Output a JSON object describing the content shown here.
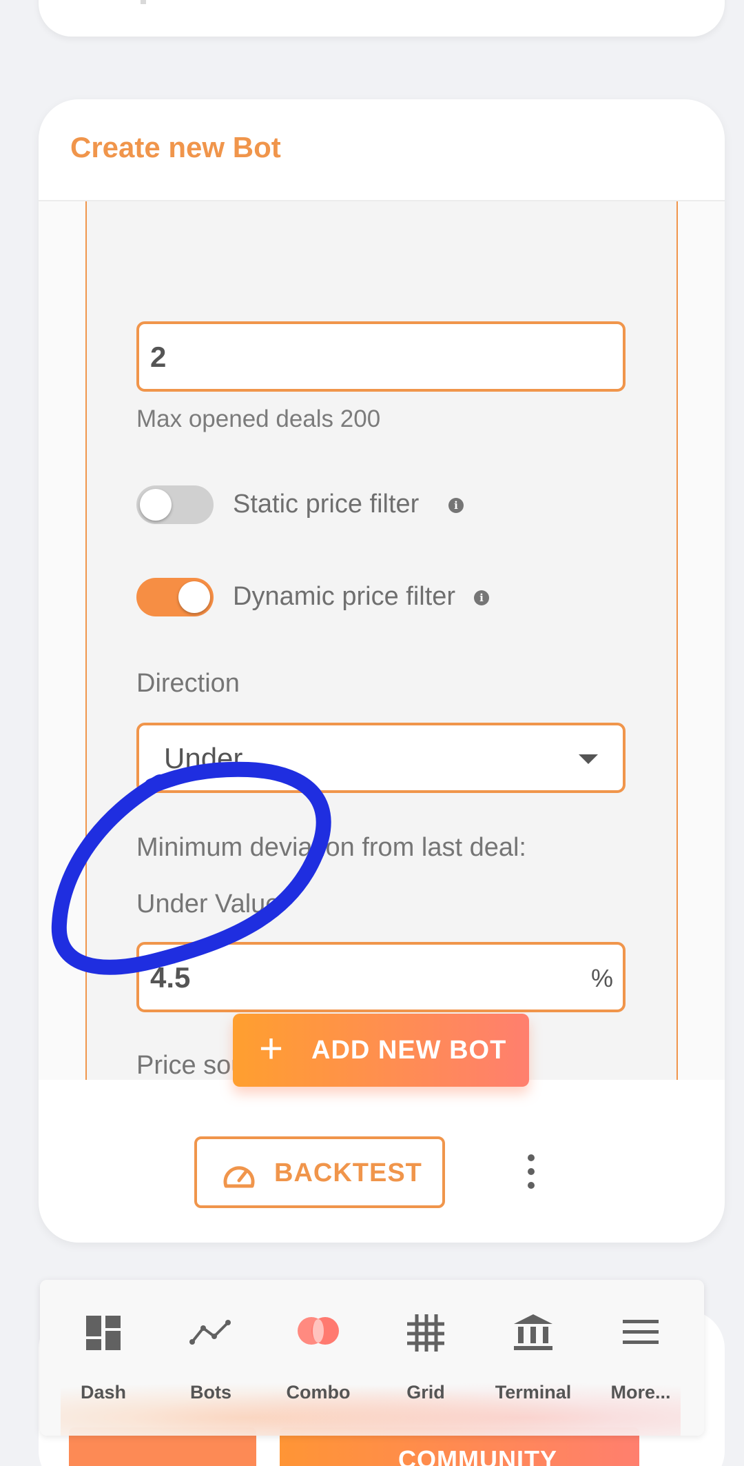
{
  "card": {
    "title": "Create new Bot"
  },
  "form": {
    "max_deals_value": "2",
    "max_deals_helper": "Max opened deals 200",
    "static_filter": {
      "label": "Static price filter",
      "enabled": false
    },
    "dynamic_filter": {
      "label": "Dynamic price filter",
      "enabled": true
    },
    "direction_label": "Direction",
    "direction_value": "Under",
    "deviation_label": "Minimum deviation from last deal:",
    "under_value_label": "Under Value",
    "under_value": "4.5",
    "under_value_suffix": "%",
    "price_source_label": "Price source"
  },
  "actions": {
    "add_bot_label": "ADD NEW BOT",
    "backtest_label": "BACKTEST"
  },
  "behind": {
    "community_label": "COMMUNITY"
  },
  "nav": [
    {
      "label": "Dash",
      "icon": "dashboard-icon"
    },
    {
      "label": "Bots",
      "icon": "line-chart-icon"
    },
    {
      "label": "Combo",
      "icon": "combo-icon"
    },
    {
      "label": "Grid",
      "icon": "grid-icon"
    },
    {
      "label": "Terminal",
      "icon": "bank-icon"
    },
    {
      "label": "More...",
      "icon": "menu-icon"
    }
  ],
  "colors": {
    "accent": "#f0954b",
    "toggle_on": "#f68e44",
    "annotation": "#1f2ee0"
  }
}
